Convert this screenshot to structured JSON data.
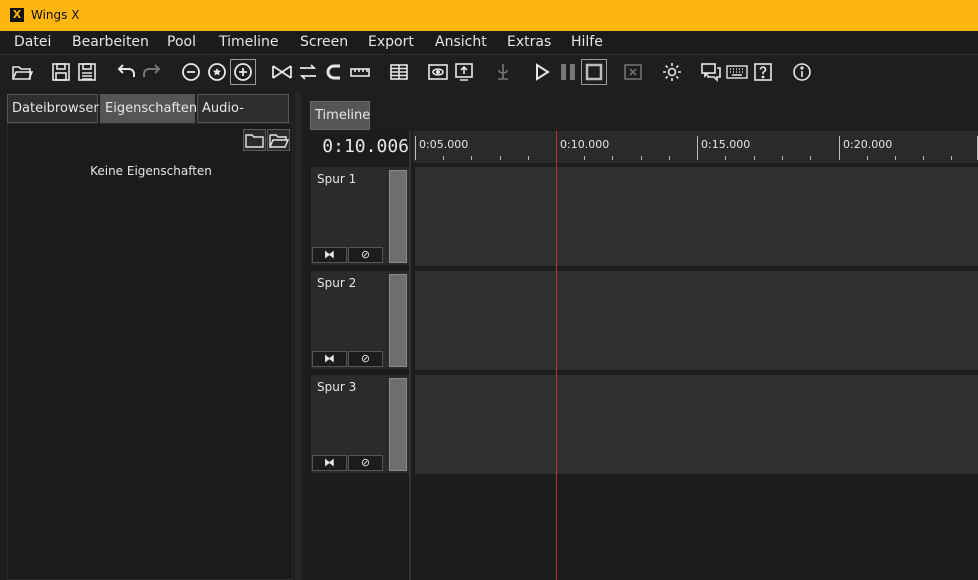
{
  "window": {
    "title": "Wings X",
    "icon_letter": "X"
  },
  "menu": [
    "Datei",
    "Bearbeiten",
    "Pool",
    "Timeline",
    "Screen",
    "Export",
    "Ansicht",
    "Extras",
    "Hilfe"
  ],
  "toolbar_icons": [
    "open-folder-icon",
    "save-icon",
    "save-all-icon",
    "undo-icon",
    "redo-icon",
    "zoom-out-icon",
    "zoom-fit-icon",
    "zoom-in-icon",
    "crop-icon",
    "swap-icon",
    "magnet-icon",
    "ruler-icon",
    "grid-icon",
    "preview-icon",
    "screen-icon",
    "audio-icon",
    "play-icon",
    "pause-icon",
    "stop-icon",
    "close-box-icon",
    "settings-icon",
    "chat-icon",
    "keyboard-icon",
    "help-icon",
    "info-icon"
  ],
  "left_panel": {
    "tabs": [
      "Dateibrowser",
      "Eigenschaften",
      "Audio-Plugins"
    ],
    "active_tab": "Eigenschaften",
    "empty_text": "Keine Eigenschaften"
  },
  "timeline": {
    "tab_label": "Timeline",
    "current_time": "0:10.006",
    "ruler_labels": [
      "0:05.000",
      "0:10.000",
      "0:15.000",
      "0:20.000"
    ],
    "tracks": [
      {
        "name": "Spur 1",
        "btn_a": "⧓",
        "btn_b": "⊘"
      },
      {
        "name": "Spur 2",
        "btn_a": "⧓",
        "btn_b": "⊘"
      },
      {
        "name": "Spur 3",
        "btn_a": "⧓",
        "btn_b": "⊘"
      }
    ]
  },
  "colors": {
    "titlebar": "#fdb50f",
    "playhead": "#c0302a",
    "background": "#1e1e1e"
  }
}
